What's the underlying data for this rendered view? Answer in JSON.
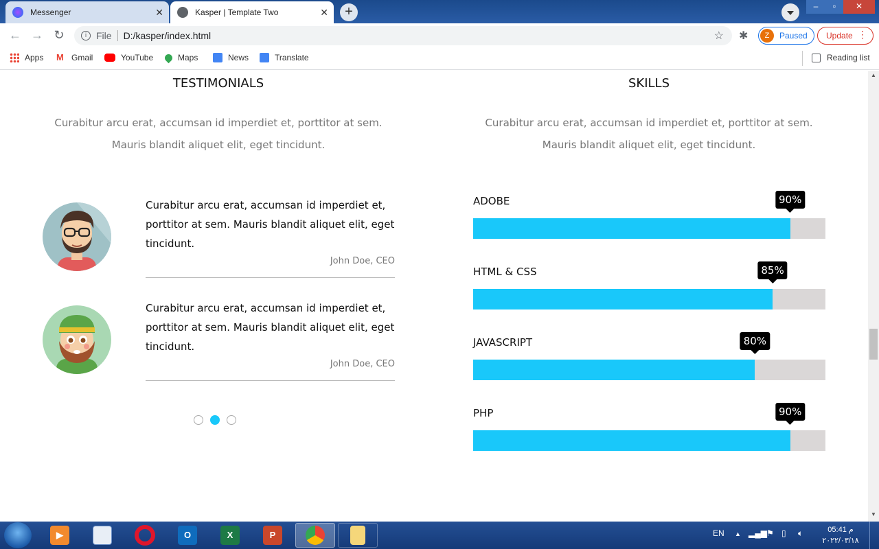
{
  "browser": {
    "tabs": [
      {
        "title": "Messenger",
        "active": false
      },
      {
        "title": "Kasper | Template Two",
        "active": true
      }
    ],
    "address": {
      "scheme": "File",
      "url": "D:/kasper/index.html"
    },
    "profile": {
      "initial": "Z",
      "status": "Paused"
    },
    "update_label": "Update",
    "bookmarks": [
      "Apps",
      "Gmail",
      "YouTube",
      "Maps",
      "News",
      "Translate"
    ],
    "reading_list": "Reading list"
  },
  "testimonials": {
    "title": "TESTIMONIALS",
    "description_line1": "Curabitur arcu erat, accumsan id imperdiet et, porttitor at sem.",
    "description_line2": "Mauris blandit aliquet elit, eget tincidunt.",
    "items": [
      {
        "line1": "Curabitur arcu erat, accumsan id imperdiet et,",
        "line2": "porttitor at sem. Mauris blandit aliquet elit, eget",
        "line3": "tincidunt.",
        "author": "John Doe, CEO"
      },
      {
        "line1": "Curabitur arcu erat, accumsan id imperdiet et,",
        "line2": "porttitor at sem. Mauris blandit aliquet elit, eget",
        "line3": "tincidunt.",
        "author": "John Doe, CEO"
      }
    ],
    "active_bullet": 2,
    "bullet_count": 3
  },
  "skills": {
    "title": "SKILLS",
    "description_line1": "Curabitur arcu erat, accumsan id imperdiet et, porttitor at sem.",
    "description_line2": "Mauris blandit aliquet elit, eget tincidunt.",
    "items": [
      {
        "name": "ADOBE",
        "percent": 90,
        "label": "90%"
      },
      {
        "name": "HTML & CSS",
        "percent": 85,
        "label": "85%"
      },
      {
        "name": "JAVASCRIPT",
        "percent": 80,
        "label": "80%"
      },
      {
        "name": "PHP",
        "percent": 90,
        "label": "90%"
      }
    ],
    "accent_color": "#19c8fa",
    "track_color": "#dad7d7"
  },
  "taskbar": {
    "language": "EN",
    "time": "05:41 م",
    "date": "٢٠٢٢/٠٣/١٨",
    "apps": [
      "windows-media-player",
      "control-panel",
      "opera",
      "outlook",
      "excel",
      "powerpoint",
      "chrome",
      "file-explorer"
    ]
  }
}
